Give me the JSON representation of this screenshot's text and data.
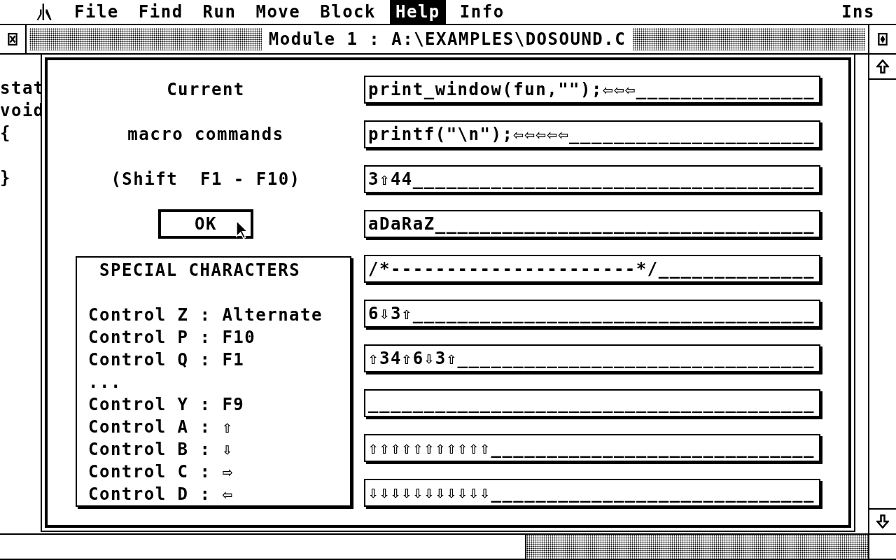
{
  "menu_bar": {
    "items": [
      {
        "label": "File",
        "selected": false
      },
      {
        "label": "Find",
        "selected": false
      },
      {
        "label": "Run",
        "selected": false
      },
      {
        "label": "Move",
        "selected": false
      },
      {
        "label": "Block",
        "selected": false
      },
      {
        "label": "Help",
        "selected": true
      },
      {
        "label": "Info",
        "selected": false
      }
    ],
    "status": "Ins"
  },
  "window": {
    "title": "Module 1 : A:\\EXAMPLES\\DOSOUND.C"
  },
  "editor": {
    "lines": [
      "stat",
      "void",
      "{",
      "}"
    ]
  },
  "dialog": {
    "heading_lines": [
      "Current",
      "macro commands",
      "(Shift  F1 - F10)"
    ],
    "ok_button": {
      "label": "OK",
      "default": true
    },
    "special_characters": {
      "title": "SPECIAL CHARACTERS",
      "lines": [
        "Control Z : Alternate",
        "Control P : F10",
        "Control Q : F1",
        "...",
        "Control Y : F9",
        "Control A : ⇧",
        "Control B : ⇩",
        "Control C : ⇨",
        "Control D : ⇦"
      ]
    },
    "macro_fields": [
      {
        "value": "print_window(fun,\"\");⇦⇦⇦________________"
      },
      {
        "value": "printf(\"\\n\");⇦⇦⇦⇦⇦______________________"
      },
      {
        "value": "3⇧44____________________________________"
      },
      {
        "value": "aDaRaZ__________________________________"
      },
      {
        "value": "/*----------------------*/______________"
      },
      {
        "value": "6⇩3⇧____________________________________"
      },
      {
        "value": "⇧34⇧6⇩3⇧________________________________"
      },
      {
        "value": "________________________________________"
      },
      {
        "value": "⇧⇧⇧⇧⇧⇧⇧⇧⇧⇧⇧_____________________________"
      },
      {
        "value": "⇩⇩⇩⇩⇩⇩⇩⇩⇩⇩⇩_____________________________"
      }
    ]
  }
}
